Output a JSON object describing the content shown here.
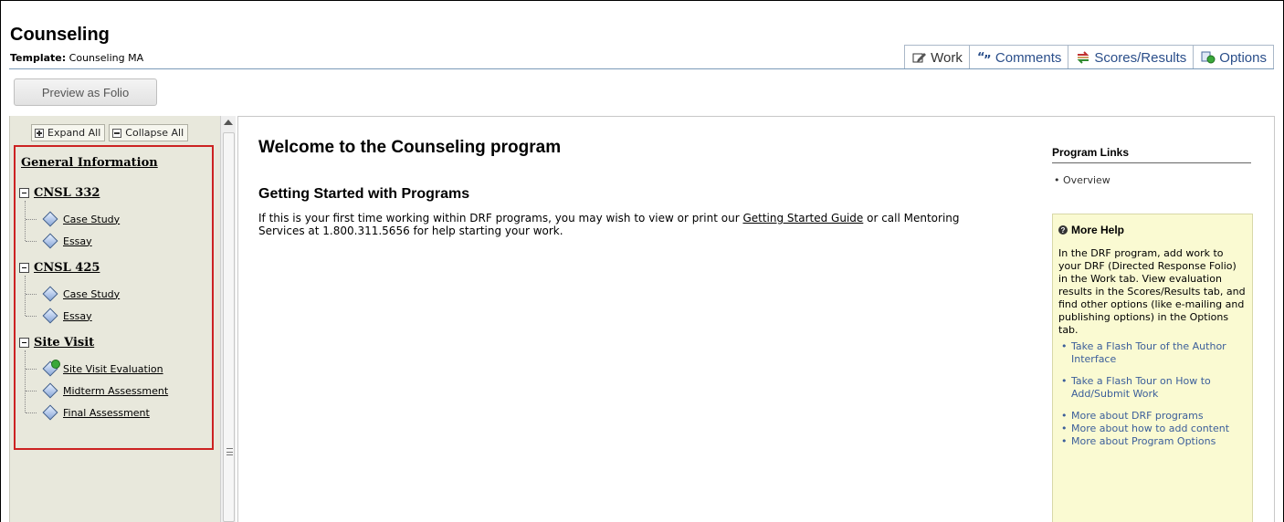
{
  "header": {
    "title": "Counseling",
    "template_label": "Template:",
    "template_value": "Counseling MA"
  },
  "tabs": [
    {
      "label": "Work",
      "icon": "pencil-icon",
      "active": true
    },
    {
      "label": "Comments",
      "icon": "quote-icon",
      "active": false
    },
    {
      "label": "Scores/Results",
      "icon": "arrows-icon",
      "active": false
    },
    {
      "label": "Options",
      "icon": "settings-icon",
      "active": false
    }
  ],
  "preview_button": "Preview as Folio",
  "tree": {
    "expand_all": "Expand All",
    "collapse_all": "Collapse All",
    "general_information": "General Information",
    "sections": [
      {
        "label": "CNSL 332",
        "items": [
          "Case Study",
          "Essay"
        ]
      },
      {
        "label": "CNSL 425",
        "items": [
          "Case Study",
          "Essay"
        ]
      },
      {
        "label": "Site Visit",
        "items": [
          "Site Visit Evaluation",
          "Midterm Assessment",
          "Final Assessment"
        ]
      }
    ]
  },
  "main": {
    "welcome": "Welcome to the Counseling program",
    "getting_started_title": "Getting Started with Programs",
    "text_before_link": "If this is your first time working within DRF programs, you may wish to view or print our ",
    "link": "Getting Started Guide",
    "text_after_link": " or call Mentoring Services at 1.800.311.5656 for help starting your work."
  },
  "program_links": {
    "title": "Program Links",
    "items": [
      "Overview"
    ]
  },
  "more_help": {
    "title": "More Help",
    "text": "In the DRF program, add work to your DRF (Directed Response Folio) in the Work tab. View evaluation results in the Scores/Results tab, and find other options (like e-mailing and publishing options) in the Options tab.",
    "links": [
      "Take a Flash Tour of the Author Interface",
      "Take a Flash Tour on How to Add/Submit Work",
      "More about DRF programs",
      "More about how to add content",
      "More about Program Options"
    ]
  },
  "colors": {
    "tab_link": "#2a4e8a",
    "sidebar_bg": "#e8e8dc",
    "highlight_border": "#cc2222",
    "help_bg": "#fafad2"
  }
}
